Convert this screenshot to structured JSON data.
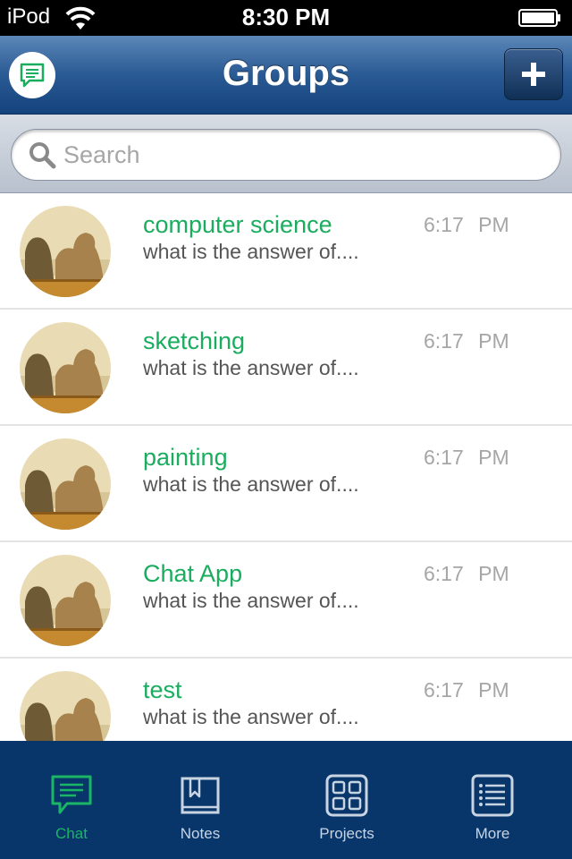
{
  "status_bar": {
    "carrier": "iPod",
    "time": "8:30 PM"
  },
  "nav": {
    "title": "Groups",
    "left_icon": "chat-bubble-icon",
    "right_icon": "plus-icon"
  },
  "search": {
    "placeholder": "Search",
    "value": ""
  },
  "groups": [
    {
      "name": "computer science",
      "preview": "what is the answer of....",
      "time": "6:17 PM"
    },
    {
      "name": "sketching",
      "preview": "what is the answer of....",
      "time": "6:17 PM"
    },
    {
      "name": "painting",
      "preview": "what is the answer of....",
      "time": "6:17 PM"
    },
    {
      "name": "Chat App",
      "preview": "what is the answer of....",
      "time": "6:17 PM"
    },
    {
      "name": "test",
      "preview": "what is the answer of....",
      "time": "6:17 PM"
    }
  ],
  "tabs": [
    {
      "label": "Chat",
      "icon": "chat-icon",
      "active": true
    },
    {
      "label": "Notes",
      "icon": "book-icon",
      "active": false
    },
    {
      "label": "Projects",
      "icon": "grid-icon",
      "active": false
    },
    {
      "label": "More",
      "icon": "list-icon",
      "active": false
    }
  ],
  "colors": {
    "accent_green": "#1aad5f",
    "nav_blue": "#2a5a94",
    "tab_bar_blue": "#08366b"
  }
}
